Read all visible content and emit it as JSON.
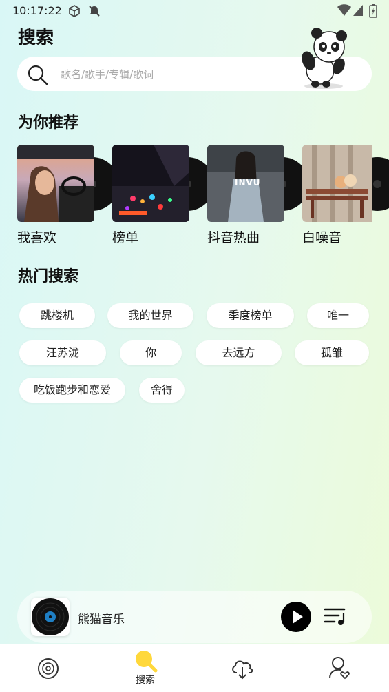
{
  "status": {
    "time": "10:17:22"
  },
  "header": {
    "title": "搜索"
  },
  "search": {
    "placeholder": "歌名/歌手/专辑/歌词"
  },
  "recommend": {
    "title": "为你推荐",
    "items": [
      {
        "label": "我喜欢"
      },
      {
        "label": "榜单"
      },
      {
        "label": "抖音热曲",
        "cover_text": "INVU"
      },
      {
        "label": "白噪音"
      }
    ]
  },
  "hot": {
    "title": "热门搜索",
    "tags": [
      "跳楼机",
      "我的世界",
      "季度榜单",
      "唯一",
      "汪苏泷",
      "你",
      "去远方",
      "孤雏",
      "吃饭跑步和恋爱",
      "舍得"
    ]
  },
  "player": {
    "title": "熊猫音乐"
  },
  "nav": {
    "items": [
      {
        "label": ""
      },
      {
        "label": "搜索"
      },
      {
        "label": ""
      },
      {
        "label": ""
      }
    ]
  }
}
